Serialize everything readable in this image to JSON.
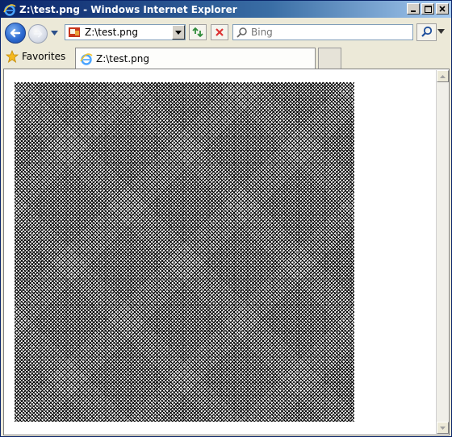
{
  "window": {
    "title": "Z:\\test.png - Windows Internet Explorer",
    "controls": [
      "minimize",
      "maximize",
      "close"
    ]
  },
  "navbar": {
    "address": "Z:\\test.png",
    "search_placeholder": "Bing"
  },
  "favorites": {
    "label": "Favorites"
  },
  "tabs": [
    {
      "label": "Z:\\test.png",
      "active": true
    }
  ],
  "colors": {
    "titlebar_start": "#0a246a",
    "titlebar_end": "#a6caf0",
    "chrome": "#ece9d8",
    "content_bg": "#ffffff"
  },
  "icons": {
    "title": "ie-logo-icon",
    "back": "back-arrow-icon",
    "forward": "forward-arrow-icon",
    "refresh": "refresh-icon",
    "stop": "stop-icon",
    "search": "search-icon",
    "favorites": "favorites-star-icon"
  }
}
